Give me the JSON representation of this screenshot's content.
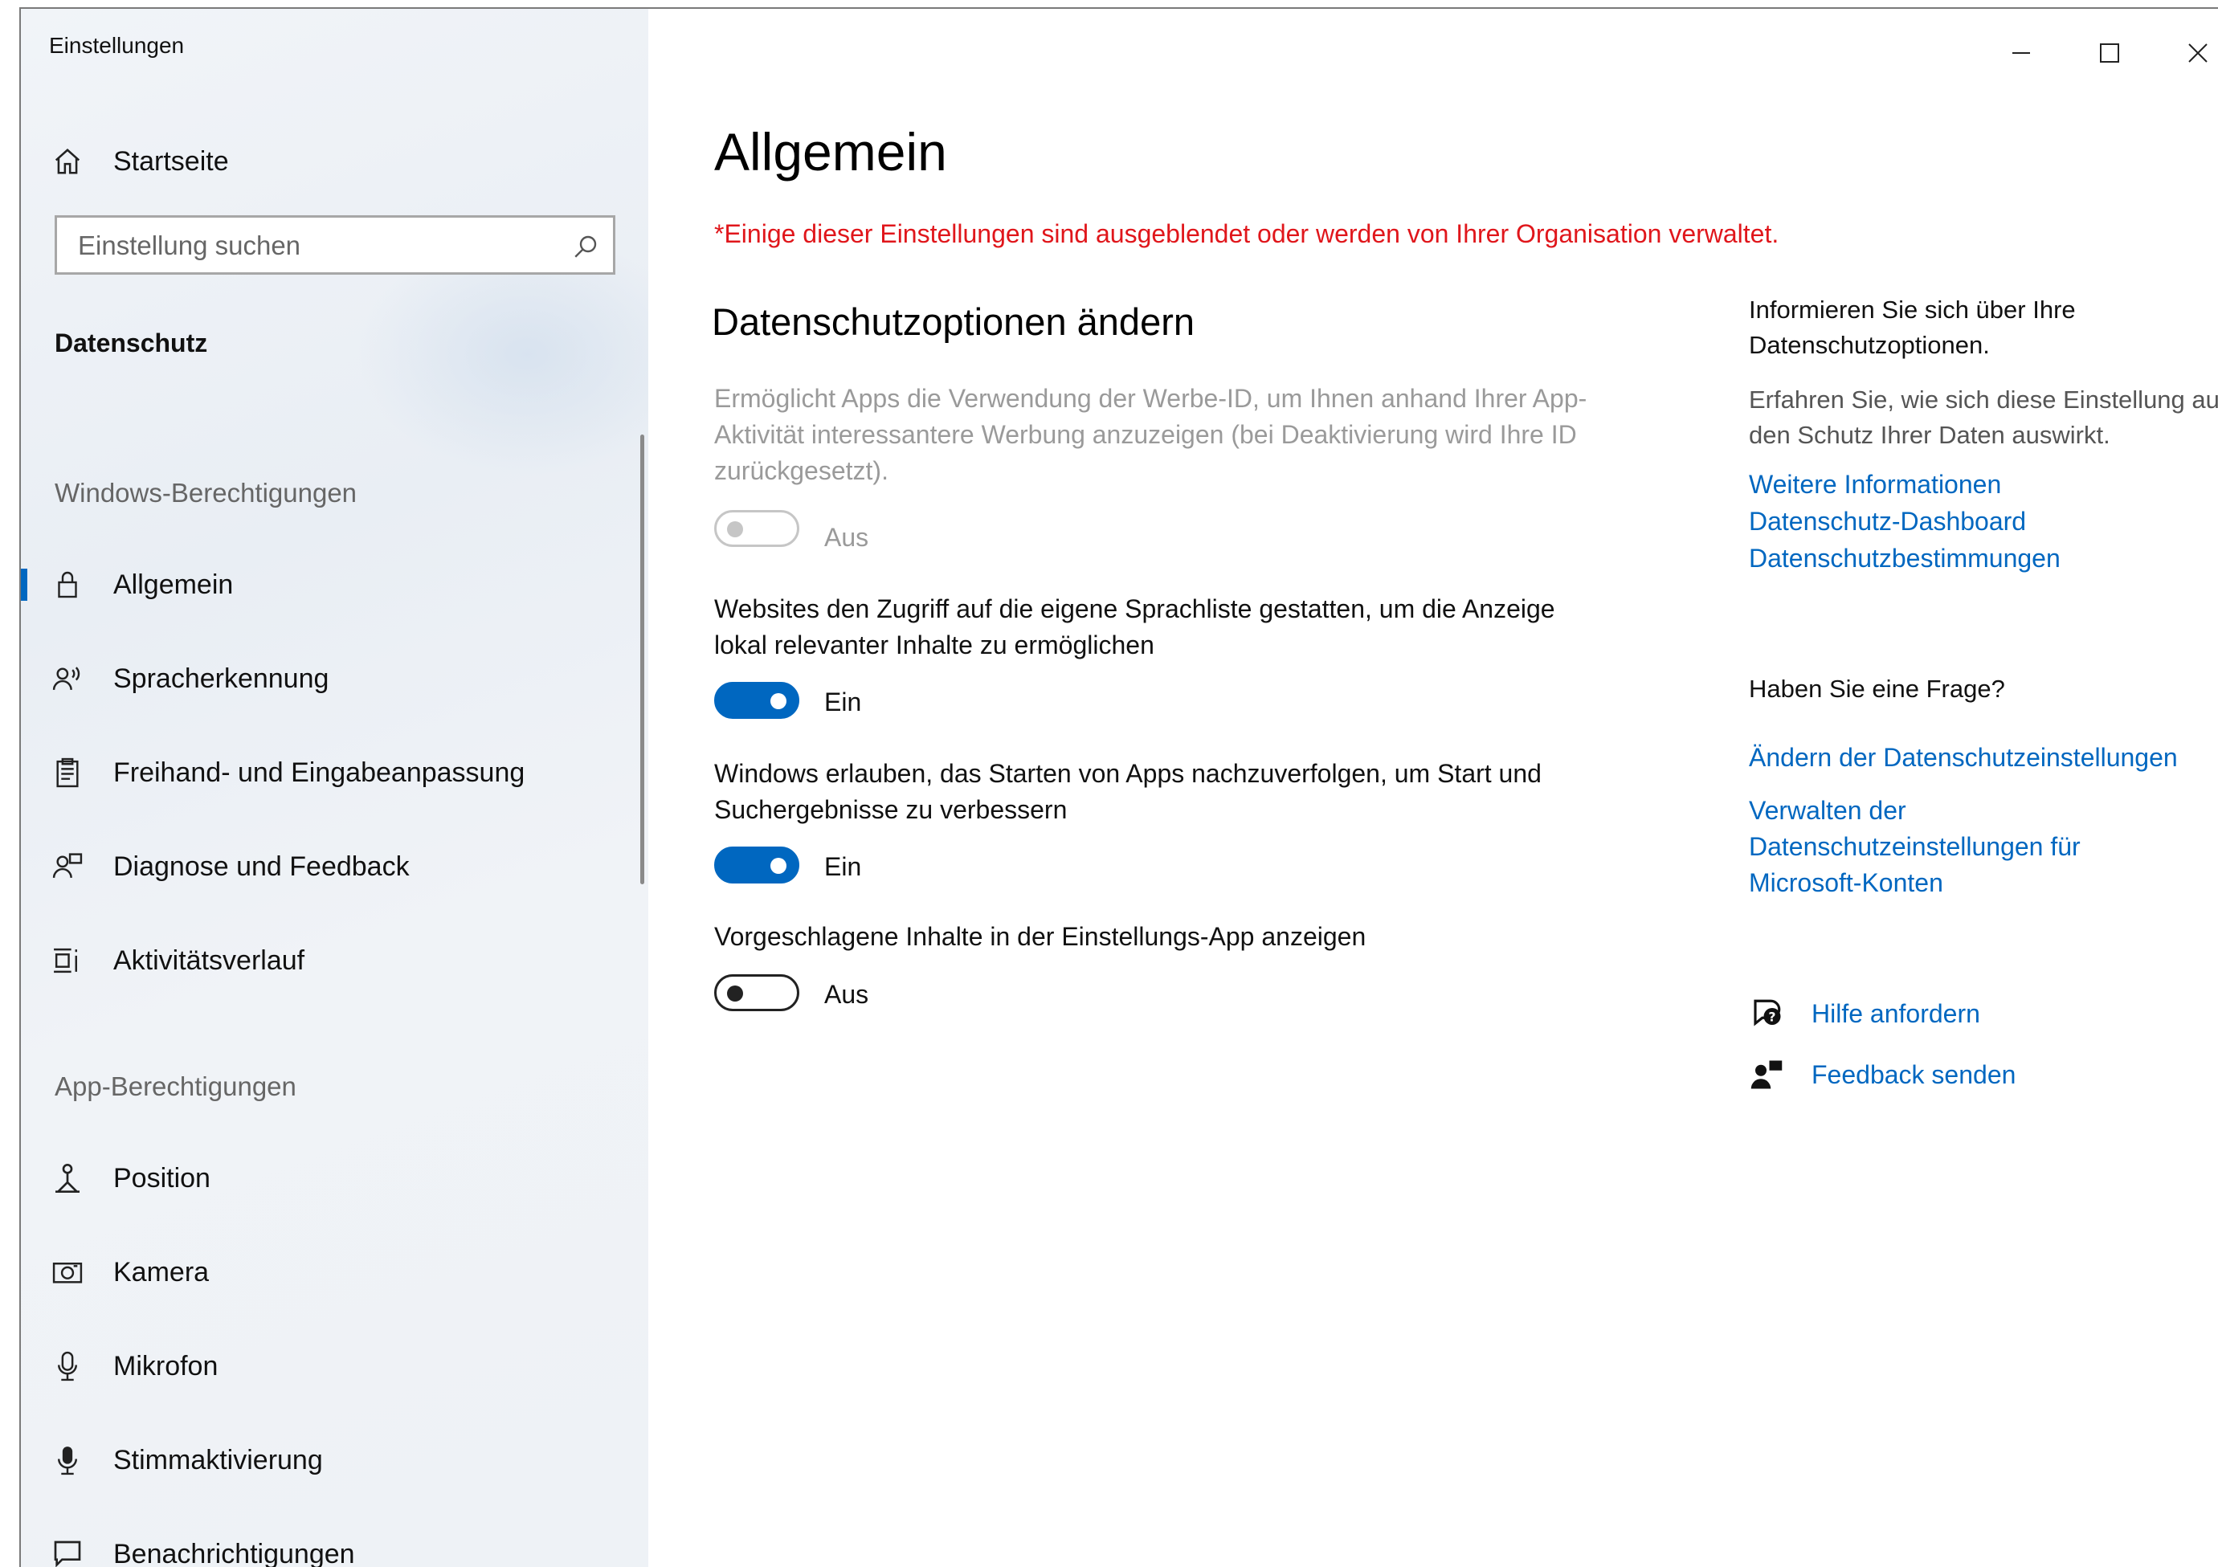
{
  "window": {
    "title": "Einstellungen",
    "controls": {
      "minimize": "—",
      "maximize": "☐",
      "close": "✕"
    }
  },
  "sidebar": {
    "home": {
      "label": "Startseite",
      "icon": "home-icon"
    },
    "search": {
      "placeholder": "Einstellung suchen",
      "value": "",
      "icon": "search-icon"
    },
    "section_title": "Datenschutz",
    "groups": [
      {
        "header": "Windows-Berechtigungen",
        "items": [
          {
            "label": "Allgemein",
            "icon": "lock-icon",
            "selected": true
          },
          {
            "label": "Spracherkennung",
            "icon": "speech-icon",
            "selected": false
          },
          {
            "label": "Freihand- und Eingabeanpassung",
            "icon": "clipboard-icon",
            "selected": false
          },
          {
            "label": "Diagnose und Feedback",
            "icon": "person-feedback-icon",
            "selected": false
          },
          {
            "label": "Aktivitätsverlauf",
            "icon": "timeline-icon",
            "selected": false
          }
        ]
      },
      {
        "header": "App-Berechtigungen",
        "items": [
          {
            "label": "Position",
            "icon": "location-icon",
            "selected": false
          },
          {
            "label": "Kamera",
            "icon": "camera-icon",
            "selected": false
          },
          {
            "label": "Mikrofon",
            "icon": "microphone-icon",
            "selected": false
          },
          {
            "label": "Stimmaktivierung",
            "icon": "voice-activation-icon",
            "selected": false
          },
          {
            "label": "Benachrichtigungen",
            "icon": "notification-icon",
            "selected": false
          }
        ]
      }
    ]
  },
  "main": {
    "title": "Allgemein",
    "warning": "*Einige dieser Einstellungen sind ausgeblendet oder werden von Ihrer Organisation verwaltet.",
    "heading": "Datenschutzoptionen ändern",
    "settings": [
      {
        "description": "Ermöglicht Apps die Verwendung der Werbe-ID, um Ihnen anhand Ihrer App-Aktivität interessantere Werbung anzuzeigen (bei Deaktivierung wird Ihre ID zurückgesetzt).",
        "state_label": "Aus",
        "on": false,
        "disabled": true
      },
      {
        "description": "Websites den Zugriff auf die eigene Sprachliste gestatten, um die Anzeige lokal relevanter Inhalte zu ermöglichen",
        "state_label": "Ein",
        "on": true,
        "disabled": false
      },
      {
        "description": "Windows erlauben, das Starten von Apps nachzuverfolgen, um Start und Suchergebnisse zu verbessern",
        "state_label": "Ein",
        "on": true,
        "disabled": false
      },
      {
        "description": "Vorgeschlagene Inhalte in der Einstellungs-App anzeigen",
        "state_label": "Aus",
        "on": false,
        "disabled": false
      }
    ]
  },
  "aside": {
    "info_title": "Informieren Sie sich über Ihre Datenschutzoptionen.",
    "info_text": "Erfahren Sie, wie sich diese Einstellung auf den Schutz Ihrer Daten auswirkt.",
    "info_links": [
      "Weitere Informationen",
      "Datenschutz-Dashboard",
      "Datenschutzbestimmungen"
    ],
    "question_title": "Haben Sie eine Frage?",
    "question_links": [
      "Ändern der Datenschutzeinstellungen",
      "Verwalten der Datenschutzeinstellungen für Microsoft-Konten"
    ],
    "help": {
      "label": "Hilfe anfordern",
      "icon": "help-chat-icon"
    },
    "feedback": {
      "label": "Feedback senden",
      "icon": "feedback-icon"
    }
  },
  "colors": {
    "accent": "#0067c0",
    "warning": "#e0161b",
    "disabled": "#9a9a9a"
  }
}
